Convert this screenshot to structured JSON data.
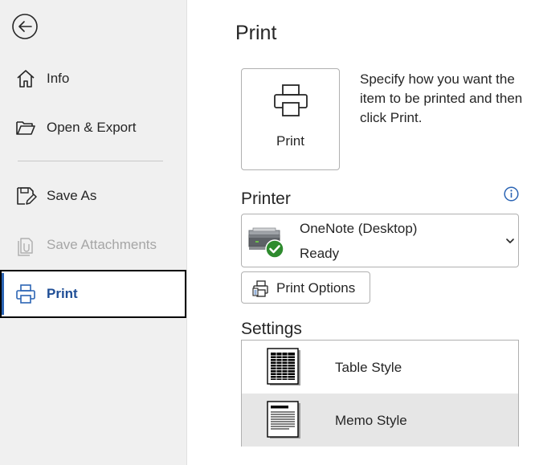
{
  "sidebar": {
    "items": [
      {
        "label": "Info",
        "icon": "home-icon"
      },
      {
        "label": "Open & Export",
        "icon": "folder-open-icon"
      },
      {
        "label": "Save As",
        "icon": "save-as-icon"
      },
      {
        "label": "Save Attachments",
        "icon": "save-attachments-icon",
        "disabled": true
      },
      {
        "label": "Print",
        "icon": "printer-icon",
        "active": true
      }
    ]
  },
  "main": {
    "title": "Print",
    "print_tile_label": "Print",
    "description": "Specify how you want the item to be printed and then click Print.",
    "printer": {
      "section_title": "Printer",
      "name": "OneNote (Desktop)",
      "status": "Ready"
    },
    "print_options_label": "Print Options",
    "settings": {
      "section_title": "Settings",
      "styles": [
        {
          "label": "Table Style",
          "selected": false
        },
        {
          "label": "Memo Style",
          "selected": true
        }
      ]
    }
  },
  "colors": {
    "accent": "#2b64b4",
    "active_text": "#1f4e96",
    "ready_check": "#2e8b2e",
    "sidebar_bg": "#f0f0f0"
  }
}
